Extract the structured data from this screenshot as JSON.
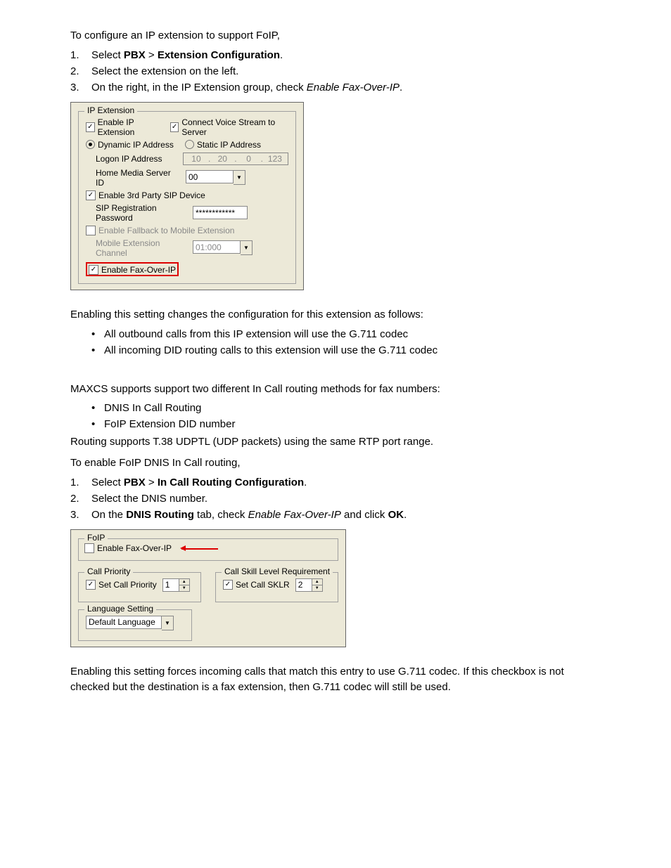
{
  "intro": "To configure an IP extension to support FoIP,",
  "steps1": [
    {
      "pre": "Select ",
      "bold": "PBX",
      "mid": " > ",
      "bold2": "Extension Configuration",
      "post": "."
    },
    {
      "text": "Select the extension on the left."
    },
    {
      "pre": "On the right, in the IP Extension group, check ",
      "italic": "Enable Fax-Over-IP",
      "post": "."
    }
  ],
  "ip_ext": {
    "legend": "IP Extension",
    "enable_ip_ext_label": "Enable IP Extension",
    "connect_voice_label": "Connect Voice Stream to Server",
    "dyn_ip_label": "Dynamic IP Address",
    "static_ip_label": "Static IP Address",
    "logon_ip_label": "Logon IP Address",
    "ip": {
      "a": "10",
      "b": "20",
      "c": "0",
      "d": "123"
    },
    "hms_label": "Home Media Server ID",
    "hms_value": "00",
    "enable_3rd_party_label": "Enable 3rd Party SIP Device",
    "sip_pw_label": "SIP Registration Password",
    "sip_pw_value": "************",
    "enable_fallback_label": "Enable Fallback to Mobile Extension",
    "mobile_ext_label": "Mobile Extension Channel",
    "mobile_ext_value": "01:000",
    "enable_fax_label": "Enable Fax-Over-IP"
  },
  "after1": "Enabling this setting changes the configuration for this extension as follows:",
  "bullets1": [
    "All outbound calls from this IP extension will use the G.711 codec",
    "All incoming DID routing calls to this extension will use the G.711 codec"
  ],
  "routing_intro": "MAXCS supports support two different In Call routing methods for fax numbers:",
  "routing_bullets": [
    "DNIS In Call Routing",
    "FoIP Extension DID number"
  ],
  "routing_note": "Routing supports T.38 UDPTL (UDP packets) using the same RTP port range.",
  "to_enable": "To enable FoIP DNIS In Call routing,",
  "steps2": [
    {
      "pre": "Select ",
      "bold": "PBX",
      "mid": " > ",
      "bold2": "In Call Routing Configuration",
      "post": "."
    },
    {
      "text": "Select the DNIS number."
    },
    {
      "pre": "On the ",
      "bold": "DNIS Routing",
      "mid2": " tab, check ",
      "italic": "Enable Fax-Over-IP",
      "mid3": " and click ",
      "bold3": "OK",
      "post": "."
    }
  ],
  "foip_box": {
    "legend": "FoIP",
    "enable_label": "Enable Fax-Over-IP",
    "call_priority_legend": "Call Priority",
    "set_call_priority_label": "Set Call Priority",
    "set_call_priority_value": "1",
    "sklr_legend": "Call Skill Level Requirement",
    "set_sklr_label": "Set Call SKLR",
    "set_sklr_value": "2",
    "lang_legend": "Language Setting",
    "lang_value": "Default Language"
  },
  "closing": "Enabling this setting forces incoming calls that match this entry to use G.711 codec. If this checkbox is not checked but the destination is a fax extension, then G.711 codec will still be used."
}
